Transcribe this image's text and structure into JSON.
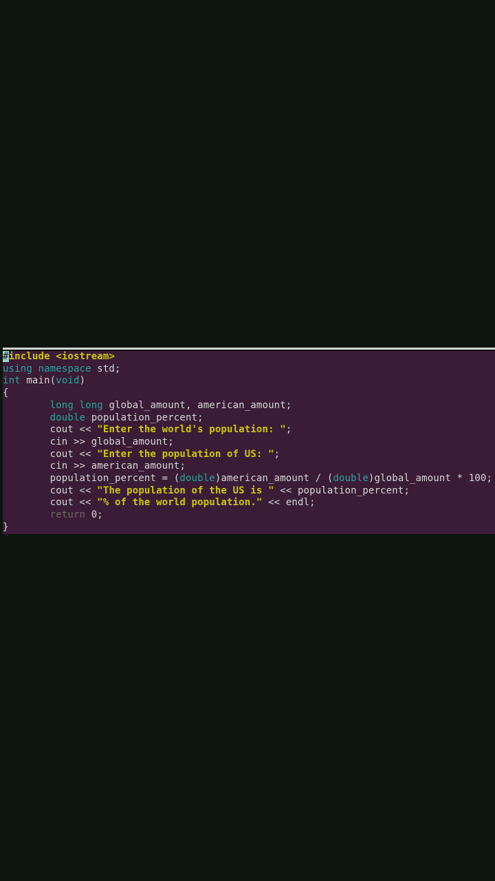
{
  "code": {
    "cursor_char": "#",
    "include_kw": "include",
    "include_header": " <iostream>",
    "using_kw": "using namespace",
    "using_ns": " std;",
    "int_kw": "int",
    "main_start": " main(",
    "void_kw": "void",
    "main_end": ")",
    "brace_open": "{",
    "indent": "        ",
    "longlong_kw": "long long",
    "ll_vars": " global_amount, american_amount;",
    "double_kw": "double",
    "dbl_var": " population_percent;",
    "cout1_a": "cout << ",
    "str1": "\"Enter the world's population: \"",
    "cout1_b": ";",
    "cin1": "cin >> global_amount;",
    "cout2_a": "cout << ",
    "str2": "\"Enter the population of US: \"",
    "cout2_b": ";",
    "cin2": "cin >> american_amount;",
    "assign_a": "population_percent = (",
    "cast1": "double",
    "assign_b": ")american_amount / (",
    "cast2": "double",
    "assign_c": ")global_amount * 100;",
    "cout3_a": "cout << ",
    "str3": "\"The population of the US is \"",
    "cout3_b": " << population_percent;",
    "cout4_a": "cout << ",
    "str4": "\"% of the world population.\"",
    "cout4_b": " << endl;",
    "return_kw": "return",
    "return_val": " 0;",
    "brace_close": "}"
  }
}
